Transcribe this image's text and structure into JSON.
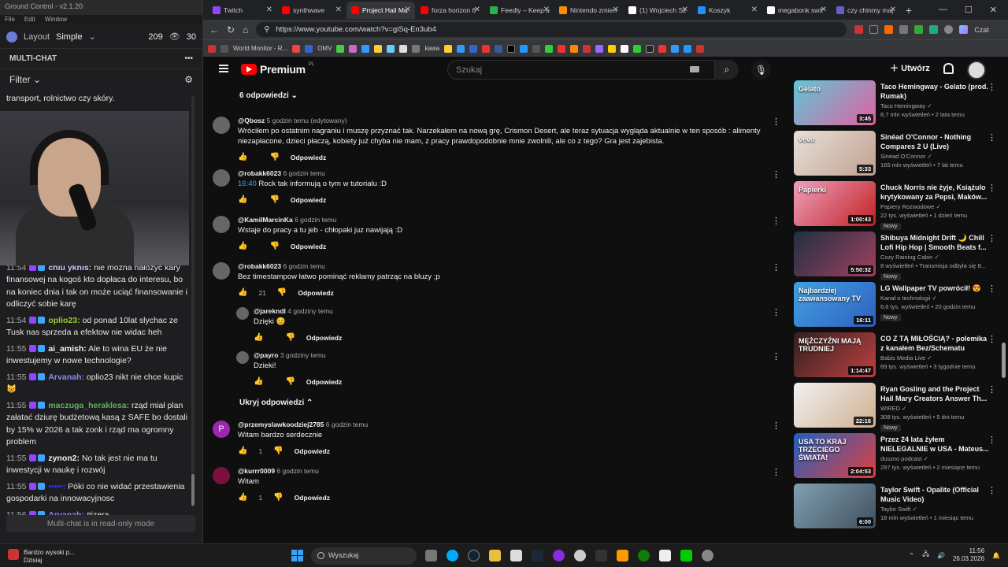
{
  "gc": {
    "title": "Ground Control - v2.1.20",
    "menu": [
      "File",
      "Edit",
      "Window"
    ],
    "layout_label": "Layout",
    "layout_value": "Simple",
    "viewers": "209",
    "viewers2": "30",
    "multichat": "MULTI-CHAT",
    "filter": "Filter",
    "footer": "Multi-chat is in read-only mode",
    "chat_top": "transport, rolnictwo czy skóry.",
    "messages": [
      {
        "time": "11:54",
        "user": "chiu yknis:",
        "color": "#c9c9ff",
        "text": "nie można nałożyć kary finansowej na kogoś kto dopłaca do interesu, bo na koniec dnia i tak on może uciąć finansowanie i odliczyć sobie karę"
      },
      {
        "time": "11:54",
        "user": "oplio23:",
        "color": "#9acd32",
        "text": "od ponad 10lat slychac ze Tusk nas sprzeda a efektow nie widac heh"
      },
      {
        "time": "11:55",
        "user": "ai_amish:",
        "color": "#f1f1f1",
        "text": "Ale to wina EU że nie inwestujemy w nowe technologie?"
      },
      {
        "time": "11:55",
        "user": "Arvanah:",
        "color": "#8a8aff",
        "text": "oplio23 nikt nie chce kupic 😸"
      },
      {
        "time": "11:55",
        "user": "maczuga_heraklesa:",
        "color": "#5fb05f",
        "text": "rząd miał plan załatać dziurę budżetową kasą z SAFE bo dostali by 15% w 2026 a tak zonk i rząd ma ogromny problem"
      },
      {
        "time": "11:55",
        "user": "zynon2:",
        "color": "#f1f1f1",
        "text": "No tak jest nie ma tu inwestycji w naukę i rozwój"
      },
      {
        "time": "11:55",
        "user": "•••••:",
        "color": "#3030ff",
        "text": "Póki co nie widać przestawienia gospodarki na innowacyjnosc"
      },
      {
        "time": "11:56",
        "user": "Arvanah:",
        "color": "#8a8aff",
        "text": "#izera"
      }
    ]
  },
  "browser": {
    "tabs": [
      {
        "label": "Twitch",
        "color": "#9146ff"
      },
      {
        "label": "synthwave",
        "color": "#f00"
      },
      {
        "label": "Project Hail Ma",
        "color": "#f00"
      },
      {
        "label": "forza horizon 6",
        "color": "#f00"
      },
      {
        "label": "Feedly – Keep u",
        "color": "#2bb24c"
      },
      {
        "label": "Nintendo zmien",
        "color": "#ff8c00"
      },
      {
        "label": "(1) Wojciech Sz",
        "color": "#fff"
      },
      {
        "label": "Koszyk",
        "color": "#1e90ff"
      },
      {
        "label": "megabonk swit",
        "color": "#fff"
      },
      {
        "label": "czy chinmy maj",
        "color": "#6a5acd"
      }
    ],
    "url": "https://www.youtube.com/watch?v=giSq-En3ub4",
    "profile": "Czat",
    "bookmarks": [
      "World Monitor - R...",
      "OMV",
      "kawa"
    ]
  },
  "yt": {
    "brand": "Premium",
    "region": "PL",
    "search_placeholder": "Szukaj",
    "create": "Utwórz",
    "replies_toggle": "6 odpowiedzi",
    "hide_replies": "Ukryj odpowiedzi",
    "reply": "Odpowiedz",
    "comments": [
      {
        "user": "@Qbosz",
        "time": "5 godzin temu (edytowany)",
        "text": "Wróciłem po ostatnim nagraniu i muszę przyznać tak. Narzekałem na nową grę, Crismon Desert, ale teraz sytuacja wygląda aktualnie w ten sposób : alimenty niezapłacone, dzieci płaczą, kobiety już chyba nie mam, z pracy prawdopodobnie mnie zwolnili, ale co z tego? Gra jest zajebista.",
        "likes": ""
      },
      {
        "user": "@robakk6023",
        "time": "6 godzin temu",
        "ts": "16:40",
        "text": "Rock tak informują o tym w tutorialu :D",
        "likes": ""
      },
      {
        "user": "@KamilMarcinKa",
        "time": "6 godzin temu",
        "text": "Wstaje do pracy a tu jeb - chłopaki juz nawijają :D",
        "likes": ""
      },
      {
        "user": "@robakk6023",
        "time": "6 godzin temu",
        "text": "Bez timestampow łatwo pominąć reklamy patrząc na bluzy ;p",
        "likes": "21"
      },
      {
        "user": "@jarekndl",
        "time": "4 godziny temu",
        "text": "Dzięki 😊",
        "likes": ""
      },
      {
        "user": "@payro",
        "time": "3 godziny temu",
        "text": "Dzieki!",
        "likes": ""
      },
      {
        "user": "@przemyslawkoodziej2785",
        "time": "6 godzin temu",
        "text": "Witam bardzo serdecznie",
        "likes": "1",
        "avatar": "P"
      },
      {
        "user": "@kurrr0009",
        "time": "6 godzin temu",
        "text": "Witam",
        "likes": "1"
      }
    ],
    "videos": [
      {
        "title": "Taco Hemingway - Gelato (prod. Rumak)",
        "channel": "Taco Hemingway",
        "stats": "8,7 mln wyświetleń • 2 lata temu",
        "dur": "3:45",
        "new": false,
        "c1": "#5ec8d8",
        "c2": "#e060a0",
        "thumb_text": "Gelato"
      },
      {
        "title": "Sinéad O'Connor - Nothing Compares 2 U (Live)",
        "channel": "Sinéad O'Connor",
        "stats": "165 mln wyświetleń • 7 lat temu",
        "dur": "5:33",
        "new": false,
        "c1": "#e8e0d8",
        "c2": "#c0a090",
        "thumb_text": "vevo"
      },
      {
        "title": "Chuck Norris nie żyje, Książulo krytykowany za Pepsi, Maków...",
        "channel": "Papiery Rozwodowe",
        "stats": "22 tys. wyświetleń • 1 dzień temu",
        "dur": "1:00:43",
        "new": true,
        "c1": "#f0a0c0",
        "c2": "#c02020",
        "thumb_text": "Papierki"
      },
      {
        "title": "Shibuya Midnight Drift 🌙 Chill Lofi Hip Hop | Smooth Beats f...",
        "channel": "Cozy Raining Cabin",
        "stats": "8 wyświetleń • Transmisja odbyła się 8...",
        "dur": "5:50:32",
        "new": true,
        "c1": "#203040",
        "c2": "#a04060",
        "thumb_text": ""
      },
      {
        "title": "LG Wallpaper TV powrócił! 😍",
        "channel": "Kanał o technologii",
        "stats": "6,6 tys. wyświetleń • 20 godzin temu",
        "dur": "16:11",
        "new": true,
        "c1": "#40a0e0",
        "c2": "#3060c0",
        "thumb_text": "Najbardziej zaawansowany TV"
      },
      {
        "title": "CO Z TĄ MIŁOŚCIĄ? - polemika z kanałem Bez/Schematu",
        "channel": "Babis Media Live",
        "stats": "69 tys. wyświetleń • 3 tygodnie temu",
        "dur": "1:14:47",
        "new": false,
        "c1": "#302020",
        "c2": "#c04040",
        "thumb_text": "MĘŻCZYŹNI MAJĄ TRUDNIEJ"
      },
      {
        "title": "Ryan Gosling and the Project Hail Mary Creators Answer Th...",
        "channel": "WIRED",
        "stats": "308 tys. wyświetleń • 5 dni temu",
        "dur": "22:16",
        "new": true,
        "c1": "#f0f0f0",
        "c2": "#d0b090",
        "thumb_text": ""
      },
      {
        "title": "Przez 24 lata żyłem NIELEGALNIE w USA - Mateus...",
        "channel": "duszno podcast",
        "stats": "297 tys. wyświetleń • 2 miesiące temu",
        "dur": "2:04:53",
        "new": false,
        "c1": "#2060c0",
        "c2": "#e04040",
        "thumb_text": "USA TO KRAJ TRZECIEGO ŚWIATA!"
      },
      {
        "title": "Taylor Swift - Opalite (Official Music Video)",
        "channel": "Taylor Swift",
        "stats": "18 mln wyświetleń • 1 miesiąc temu",
        "dur": "6:00",
        "new": false,
        "c1": "#80a0b0",
        "c2": "#405060",
        "thumb_text": ""
      }
    ]
  },
  "taskbar": {
    "weather_title": "Bardzo wysoki p...",
    "weather_sub": "Dzisiaj",
    "search": "Wyszukaj",
    "time": "11:56",
    "date": "26.03.2026"
  }
}
